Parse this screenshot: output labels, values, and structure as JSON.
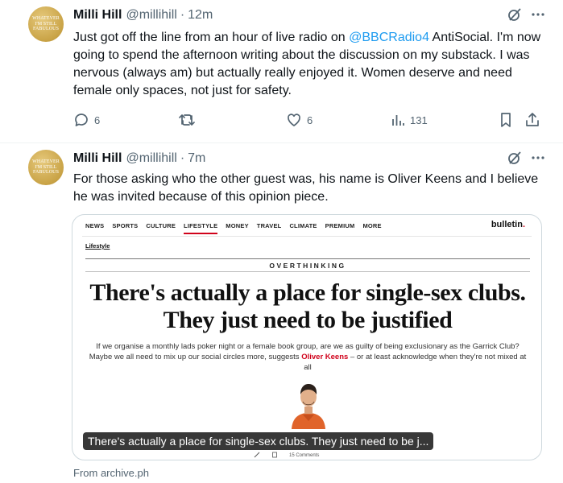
{
  "tweets": [
    {
      "author_name": "Milli Hill",
      "handle": "@millihill",
      "separator": "·",
      "time": "12m",
      "avatar_text": [
        "WHATEVER",
        "I'M STILL",
        "FABULOUS"
      ],
      "text_parts": [
        "Just got off the line from an hour of live radio on ",
        "@BBCRadio4",
        " AntiSocial. I'm now going to spend the afternoon writing about the discussion on my substack. I was nervous (always am) but actually really enjoyed it. Women deserve and need female only spaces, not just for safety."
      ],
      "actions": {
        "replies": "6",
        "likes": "6",
        "views": "131"
      }
    },
    {
      "author_name": "Milli Hill",
      "handle": "@millihill",
      "separator": "·",
      "time": "7m",
      "avatar_text": [
        "WHATEVER",
        "I'M STILL",
        "FABULOUS"
      ],
      "text": "For those asking who the other guest was, his name is Oliver Keens and I believe he was invited because of this opinion piece.",
      "card": {
        "nav": [
          "NEWS",
          "SPORTS",
          "CULTURE",
          "LIFESTYLE",
          "MONEY",
          "TRAVEL",
          "CLIMATE",
          "PREMIUM",
          "MORE"
        ],
        "active_nav": "LIFESTYLE",
        "brand": "bulletin",
        "brand_dot": ".",
        "section": "Lifestyle",
        "kicker": "OVERTHINKING",
        "headline": "There's actually a place for single-sex clubs. They just need to be justified",
        "standfirst_before": "If we organise a monthly lads poker night or a female book group, are we as guilty of being exclusionary as the Garrick Club? Maybe we all need to mix up our social circles more, suggests ",
        "standfirst_author": "Oliver Keens",
        "standfirst_after": " – or at least acknowledge when they're not mixed at all",
        "caption": "There's actually a place for single-sex clubs. They just need to be j...",
        "comments": "15 Comments"
      },
      "source": "From archive.ph"
    }
  ],
  "colors": {
    "text": "#0f1419",
    "secondary": "#536471",
    "link": "#1d9bf0",
    "accent_red": "#d0021b",
    "border": "#cfd9de"
  },
  "icons": [
    "grok-icon",
    "more-icon",
    "reply-icon",
    "retweet-icon",
    "like-icon",
    "views-icon",
    "bookmark-icon",
    "share-icon"
  ]
}
